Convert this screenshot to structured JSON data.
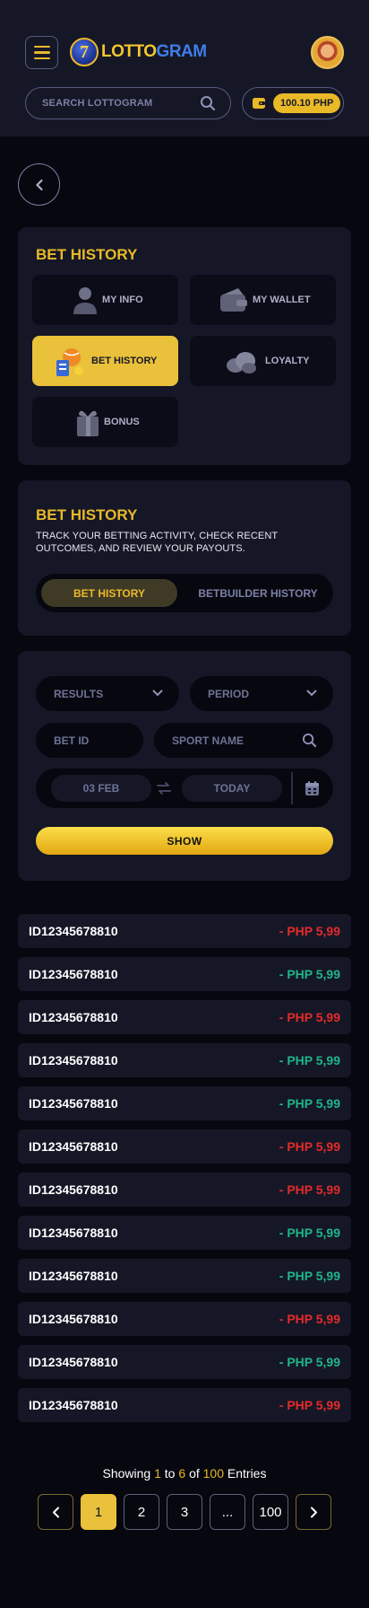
{
  "header": {
    "logo_digit": "7",
    "logo_text_a": "LOTTO",
    "logo_text_b": "GRAM",
    "search_placeholder": "SEARCH LOTTOGRAM",
    "balance": "100.10 PHP"
  },
  "menu": {
    "title": "BET HISTORY",
    "items": [
      {
        "label": "MY INFO",
        "icon": "user-icon"
      },
      {
        "label": "MY WALLET",
        "icon": "wallet-icon"
      },
      {
        "label": "BET HISTORY",
        "icon": "bet-history-icon",
        "active": true
      },
      {
        "label": "LOYALTY",
        "icon": "loyalty-icon"
      },
      {
        "label": "BONUS",
        "icon": "bonus-icon"
      }
    ]
  },
  "history": {
    "title": "BET HISTORY",
    "description": "TRACK YOUR BETTING ACTIVITY, CHECK RECENT OUTCOMES, AND REVIEW YOUR PAYOUTS.",
    "tabs": [
      "BET HISTORY",
      "BETBUILDER HISTORY"
    ]
  },
  "filters": {
    "results": "RESULTS",
    "period": "PERIOD",
    "bet_id": "BET ID",
    "sport_name": "SPORT NAME",
    "date_from": "03 FEB",
    "date_to": "TODAY",
    "show": "SHOW"
  },
  "rows": [
    {
      "id": "ID12345678810",
      "amount": "- PHP 5,99",
      "sign": "neg"
    },
    {
      "id": "ID12345678810",
      "amount": "- PHP 5,99",
      "sign": "pos"
    },
    {
      "id": "ID12345678810",
      "amount": "- PHP 5,99",
      "sign": "neg"
    },
    {
      "id": "ID12345678810",
      "amount": "- PHP 5,99",
      "sign": "pos"
    },
    {
      "id": "ID12345678810",
      "amount": "- PHP 5,99",
      "sign": "pos"
    },
    {
      "id": "ID12345678810",
      "amount": "- PHP 5,99",
      "sign": "neg"
    },
    {
      "id": "ID12345678810",
      "amount": "- PHP 5,99",
      "sign": "neg"
    },
    {
      "id": "ID12345678810",
      "amount": "- PHP 5,99",
      "sign": "pos"
    },
    {
      "id": "ID12345678810",
      "amount": "- PHP 5,99",
      "sign": "pos"
    },
    {
      "id": "ID12345678810",
      "amount": "- PHP 5,99",
      "sign": "neg"
    },
    {
      "id": "ID12345678810",
      "amount": "- PHP 5,99",
      "sign": "pos"
    },
    {
      "id": "ID12345678810",
      "amount": "- PHP 5,99",
      "sign": "neg"
    }
  ],
  "pagination": {
    "showing_prefix": "Showing",
    "from": "1",
    "to_word": "to",
    "to": "6",
    "of_word": "of",
    "total": "100",
    "entries_word": "Entries",
    "pages": [
      "1",
      "2",
      "3",
      "...",
      "100"
    ]
  },
  "colors": {
    "accent": "#e9b928",
    "negative": "#e52a2a",
    "positive": "#1fb58a"
  }
}
